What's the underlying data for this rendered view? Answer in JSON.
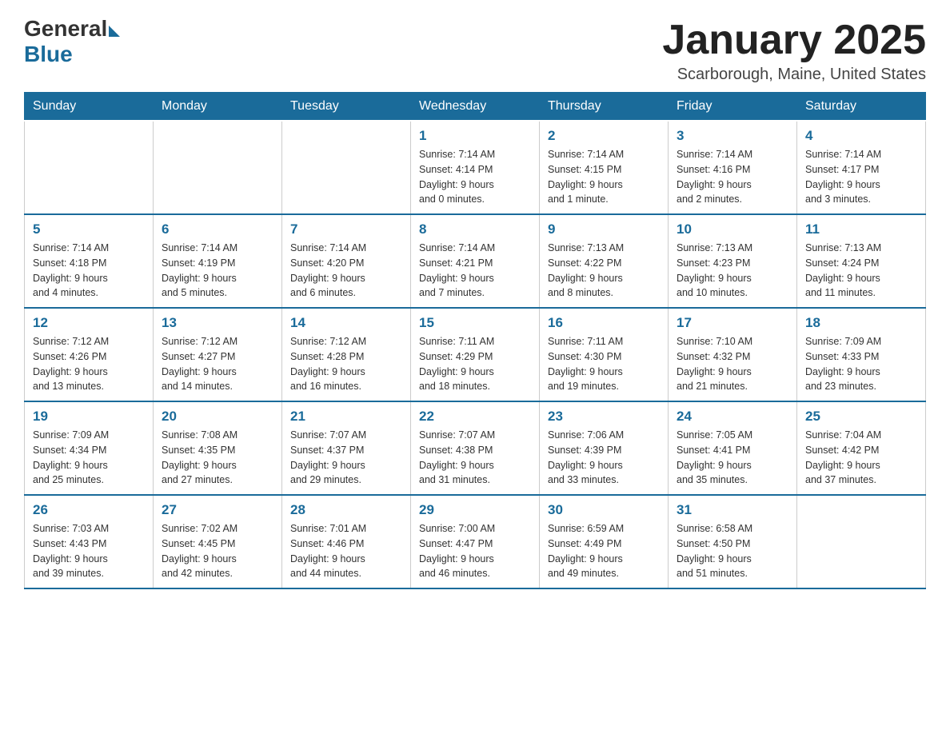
{
  "header": {
    "logo_general": "General",
    "logo_blue": "Blue",
    "month_title": "January 2025",
    "location": "Scarborough, Maine, United States"
  },
  "days_of_week": [
    "Sunday",
    "Monday",
    "Tuesday",
    "Wednesday",
    "Thursday",
    "Friday",
    "Saturday"
  ],
  "weeks": [
    [
      {
        "day": "",
        "info": ""
      },
      {
        "day": "",
        "info": ""
      },
      {
        "day": "",
        "info": ""
      },
      {
        "day": "1",
        "info": "Sunrise: 7:14 AM\nSunset: 4:14 PM\nDaylight: 9 hours\nand 0 minutes."
      },
      {
        "day": "2",
        "info": "Sunrise: 7:14 AM\nSunset: 4:15 PM\nDaylight: 9 hours\nand 1 minute."
      },
      {
        "day": "3",
        "info": "Sunrise: 7:14 AM\nSunset: 4:16 PM\nDaylight: 9 hours\nand 2 minutes."
      },
      {
        "day": "4",
        "info": "Sunrise: 7:14 AM\nSunset: 4:17 PM\nDaylight: 9 hours\nand 3 minutes."
      }
    ],
    [
      {
        "day": "5",
        "info": "Sunrise: 7:14 AM\nSunset: 4:18 PM\nDaylight: 9 hours\nand 4 minutes."
      },
      {
        "day": "6",
        "info": "Sunrise: 7:14 AM\nSunset: 4:19 PM\nDaylight: 9 hours\nand 5 minutes."
      },
      {
        "day": "7",
        "info": "Sunrise: 7:14 AM\nSunset: 4:20 PM\nDaylight: 9 hours\nand 6 minutes."
      },
      {
        "day": "8",
        "info": "Sunrise: 7:14 AM\nSunset: 4:21 PM\nDaylight: 9 hours\nand 7 minutes."
      },
      {
        "day": "9",
        "info": "Sunrise: 7:13 AM\nSunset: 4:22 PM\nDaylight: 9 hours\nand 8 minutes."
      },
      {
        "day": "10",
        "info": "Sunrise: 7:13 AM\nSunset: 4:23 PM\nDaylight: 9 hours\nand 10 minutes."
      },
      {
        "day": "11",
        "info": "Sunrise: 7:13 AM\nSunset: 4:24 PM\nDaylight: 9 hours\nand 11 minutes."
      }
    ],
    [
      {
        "day": "12",
        "info": "Sunrise: 7:12 AM\nSunset: 4:26 PM\nDaylight: 9 hours\nand 13 minutes."
      },
      {
        "day": "13",
        "info": "Sunrise: 7:12 AM\nSunset: 4:27 PM\nDaylight: 9 hours\nand 14 minutes."
      },
      {
        "day": "14",
        "info": "Sunrise: 7:12 AM\nSunset: 4:28 PM\nDaylight: 9 hours\nand 16 minutes."
      },
      {
        "day": "15",
        "info": "Sunrise: 7:11 AM\nSunset: 4:29 PM\nDaylight: 9 hours\nand 18 minutes."
      },
      {
        "day": "16",
        "info": "Sunrise: 7:11 AM\nSunset: 4:30 PM\nDaylight: 9 hours\nand 19 minutes."
      },
      {
        "day": "17",
        "info": "Sunrise: 7:10 AM\nSunset: 4:32 PM\nDaylight: 9 hours\nand 21 minutes."
      },
      {
        "day": "18",
        "info": "Sunrise: 7:09 AM\nSunset: 4:33 PM\nDaylight: 9 hours\nand 23 minutes."
      }
    ],
    [
      {
        "day": "19",
        "info": "Sunrise: 7:09 AM\nSunset: 4:34 PM\nDaylight: 9 hours\nand 25 minutes."
      },
      {
        "day": "20",
        "info": "Sunrise: 7:08 AM\nSunset: 4:35 PM\nDaylight: 9 hours\nand 27 minutes."
      },
      {
        "day": "21",
        "info": "Sunrise: 7:07 AM\nSunset: 4:37 PM\nDaylight: 9 hours\nand 29 minutes."
      },
      {
        "day": "22",
        "info": "Sunrise: 7:07 AM\nSunset: 4:38 PM\nDaylight: 9 hours\nand 31 minutes."
      },
      {
        "day": "23",
        "info": "Sunrise: 7:06 AM\nSunset: 4:39 PM\nDaylight: 9 hours\nand 33 minutes."
      },
      {
        "day": "24",
        "info": "Sunrise: 7:05 AM\nSunset: 4:41 PM\nDaylight: 9 hours\nand 35 minutes."
      },
      {
        "day": "25",
        "info": "Sunrise: 7:04 AM\nSunset: 4:42 PM\nDaylight: 9 hours\nand 37 minutes."
      }
    ],
    [
      {
        "day": "26",
        "info": "Sunrise: 7:03 AM\nSunset: 4:43 PM\nDaylight: 9 hours\nand 39 minutes."
      },
      {
        "day": "27",
        "info": "Sunrise: 7:02 AM\nSunset: 4:45 PM\nDaylight: 9 hours\nand 42 minutes."
      },
      {
        "day": "28",
        "info": "Sunrise: 7:01 AM\nSunset: 4:46 PM\nDaylight: 9 hours\nand 44 minutes."
      },
      {
        "day": "29",
        "info": "Sunrise: 7:00 AM\nSunset: 4:47 PM\nDaylight: 9 hours\nand 46 minutes."
      },
      {
        "day": "30",
        "info": "Sunrise: 6:59 AM\nSunset: 4:49 PM\nDaylight: 9 hours\nand 49 minutes."
      },
      {
        "day": "31",
        "info": "Sunrise: 6:58 AM\nSunset: 4:50 PM\nDaylight: 9 hours\nand 51 minutes."
      },
      {
        "day": "",
        "info": ""
      }
    ]
  ]
}
